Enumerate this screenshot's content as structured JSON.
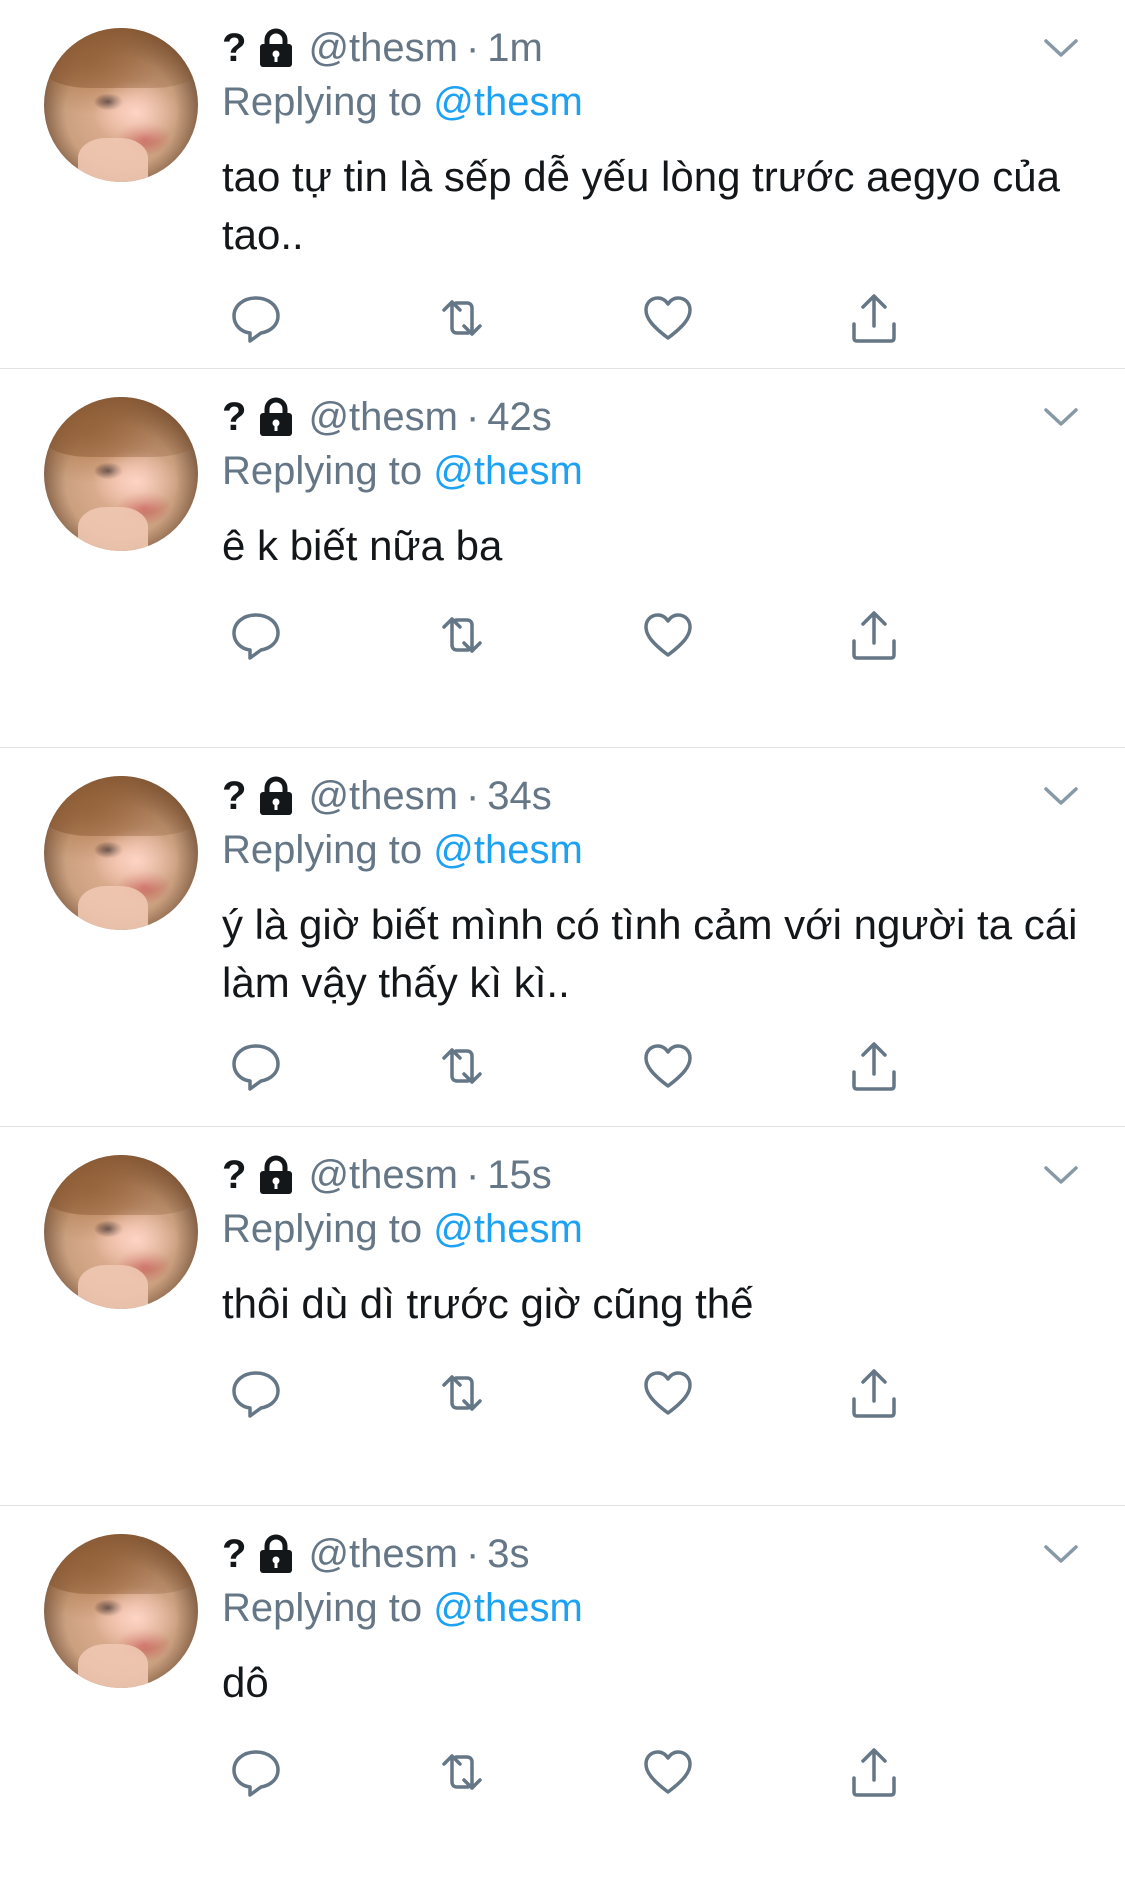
{
  "colors": {
    "text": "#14171a",
    "muted": "#657786",
    "link": "#1da1f2",
    "divider": "#dfe3e6",
    "icon": "#657786"
  },
  "icons": {
    "lock": "lock-icon",
    "caret": "chevron-down-icon",
    "reply": "reply-icon",
    "retweet": "retweet-icon",
    "like": "heart-icon",
    "share": "share-icon"
  },
  "tweets": [
    {
      "name": "?",
      "handle": "@thesm",
      "separator": "·",
      "time": "1m",
      "replying_label": "Replying to",
      "replying_to": "@thesm",
      "text": "tao tự tin là sếp dễ yếu lòng trước aegyo của tao.."
    },
    {
      "name": "?",
      "handle": "@thesm",
      "separator": "·",
      "time": "42s",
      "replying_label": "Replying to",
      "replying_to": "@thesm",
      "text": "ê k biết nữa ba"
    },
    {
      "name": "?",
      "handle": "@thesm",
      "separator": "·",
      "time": "34s",
      "replying_label": "Replying to",
      "replying_to": "@thesm",
      "text": "ý là giờ biết mình có tình cảm với người ta cái làm vậy thấy kì kì.."
    },
    {
      "name": "?",
      "handle": "@thesm",
      "separator": "·",
      "time": "15s",
      "replying_label": "Replying to",
      "replying_to": "@thesm",
      "text": "thôi dù dì trước giờ cũng thế"
    },
    {
      "name": "?",
      "handle": "@thesm",
      "separator": "·",
      "time": "3s",
      "replying_label": "Replying to",
      "replying_to": "@thesm",
      "text": "dô"
    }
  ]
}
